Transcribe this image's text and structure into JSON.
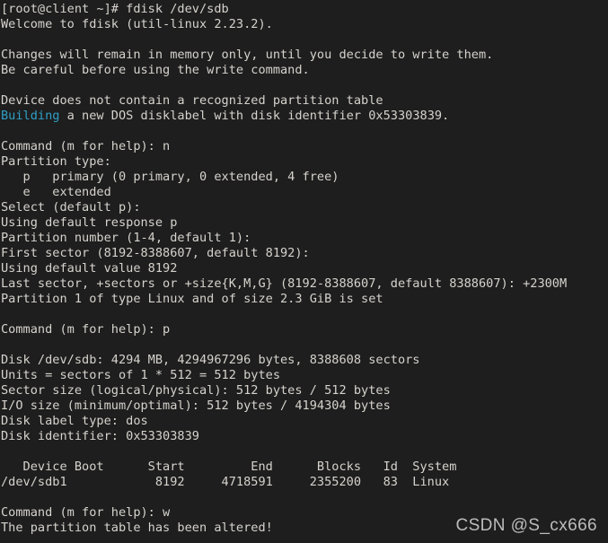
{
  "terminal": {
    "background_color": "#1e1e1e",
    "foreground_color": "#d6d3cd",
    "accent_color": "#2f9fc6",
    "lines": [
      {
        "id": "prompt-fdisk",
        "text": "[root@client ~]# fdisk /dev/sdb",
        "color": "default"
      },
      {
        "id": "welcome",
        "text": "Welcome to fdisk (util-linux 2.23.2).",
        "color": "default"
      },
      {
        "id": "blank-1",
        "text": "",
        "color": "default"
      },
      {
        "id": "changes-notice",
        "text": "Changes will remain in memory only, until you decide to write them.",
        "color": "default"
      },
      {
        "id": "careful-notice",
        "text": "Be careful before using the write command.",
        "color": "default"
      },
      {
        "id": "blank-2",
        "text": "",
        "color": "default"
      },
      {
        "id": "no-partition-table",
        "text": "Device does not contain a recognized partition table",
        "color": "default"
      },
      {
        "id": "building-disklabel",
        "text": "Building a new DOS disklabel with disk identifier 0x53303839.",
        "color": "default",
        "segments": [
          {
            "text": "Building",
            "color": "cyan"
          },
          {
            "text": " a new DOS disklabel with disk identifier 0x53303839.",
            "color": "default"
          }
        ]
      },
      {
        "id": "blank-3",
        "text": "",
        "color": "default"
      },
      {
        "id": "command-n",
        "text": "Command (m for help): n",
        "color": "default"
      },
      {
        "id": "partition-type-header",
        "text": "Partition type:",
        "color": "default"
      },
      {
        "id": "partition-type-primary",
        "text": "   p   primary (0 primary, 0 extended, 4 free)",
        "color": "default"
      },
      {
        "id": "partition-type-extended",
        "text": "   e   extended",
        "color": "default"
      },
      {
        "id": "select-default",
        "text": "Select (default p):",
        "color": "default"
      },
      {
        "id": "using-default-response",
        "text": "Using default response p",
        "color": "default"
      },
      {
        "id": "partition-number",
        "text": "Partition number (1-4, default 1):",
        "color": "default"
      },
      {
        "id": "first-sector",
        "text": "First sector (8192-8388607, default 8192):",
        "color": "default"
      },
      {
        "id": "using-default-value",
        "text": "Using default value 8192",
        "color": "default"
      },
      {
        "id": "last-sector",
        "text": "Last sector, +sectors or +size{K,M,G} (8192-8388607, default 8388607): +2300M",
        "color": "default"
      },
      {
        "id": "partition-created",
        "text": "Partition 1 of type Linux and of size 2.3 GiB is set",
        "color": "default"
      },
      {
        "id": "blank-4",
        "text": "",
        "color": "default"
      },
      {
        "id": "command-p",
        "text": "Command (m for help): p",
        "color": "default"
      },
      {
        "id": "blank-5",
        "text": "",
        "color": "default"
      },
      {
        "id": "disk-summary",
        "text": "Disk /dev/sdb: 4294 MB, 4294967296 bytes, 8388608 sectors",
        "color": "default"
      },
      {
        "id": "units",
        "text": "Units = sectors of 1 * 512 = 512 bytes",
        "color": "default"
      },
      {
        "id": "sector-size",
        "text": "Sector size (logical/physical): 512 bytes / 512 bytes",
        "color": "default"
      },
      {
        "id": "io-size",
        "text": "I/O size (minimum/optimal): 512 bytes / 4194304 bytes",
        "color": "default"
      },
      {
        "id": "disk-label-type",
        "text": "Disk label type: dos",
        "color": "default"
      },
      {
        "id": "disk-identifier",
        "text": "Disk identifier: 0x53303839",
        "color": "default"
      },
      {
        "id": "blank-6",
        "text": "",
        "color": "default"
      },
      {
        "id": "partition-table-header",
        "text": "   Device Boot      Start         End      Blocks   Id  System",
        "color": "default"
      },
      {
        "id": "partition-table-row-1",
        "text": "/dev/sdb1            8192     4718591     2355200   83  Linux",
        "color": "default"
      },
      {
        "id": "blank-7",
        "text": "",
        "color": "default"
      },
      {
        "id": "command-w",
        "text": "Command (m for help): w",
        "color": "default"
      },
      {
        "id": "table-altered",
        "text": "The partition table has been altered!",
        "color": "default"
      }
    ]
  },
  "disk_info": {
    "device": "/dev/sdb",
    "size_mb": "4294 MB",
    "size_bytes": "4294967296 bytes",
    "sectors": "8388608 sectors",
    "units": "sectors of 1 * 512 = 512 bytes",
    "sector_size_logical": "512 bytes",
    "sector_size_physical": "512 bytes",
    "io_size_minimum": "512 bytes",
    "io_size_optimal": "4194304 bytes",
    "label_type": "dos",
    "identifier": "0x53303839",
    "fdisk_version": "util-linux 2.23.2"
  },
  "partition_table": {
    "columns": [
      "Device Boot",
      "Start",
      "End",
      "Blocks",
      "Id",
      "System"
    ],
    "rows": [
      {
        "device": "/dev/sdb1",
        "boot": "",
        "start": "8192",
        "end": "4718591",
        "blocks": "2355200",
        "id": "83",
        "system": "Linux"
      }
    ]
  },
  "session": {
    "prompt": "[root@client ~]#",
    "command": "fdisk /dev/sdb",
    "commands_entered": [
      "n",
      "p",
      "w"
    ],
    "partition_size_entered": "+2300M",
    "partition_created_size": "2.3 GiB",
    "partition_number": "1",
    "partition_type": "Linux"
  },
  "watermark": {
    "text": "CSDN @S_cx666"
  }
}
